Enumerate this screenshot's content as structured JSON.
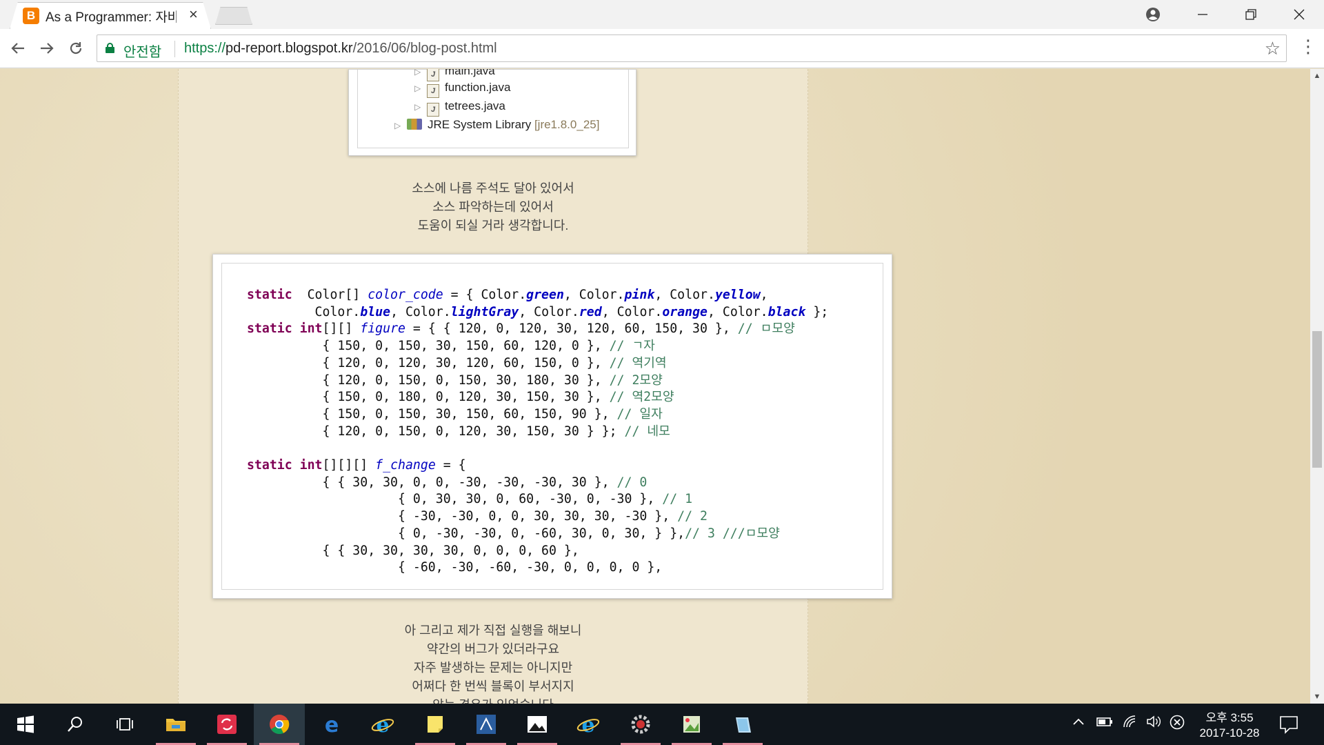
{
  "browser": {
    "tab_title": "As a Programmer: 자바",
    "tab_favicon": "B",
    "tab_close": "×",
    "secure_label": "안전함",
    "url_scheme": "https://",
    "url_host": "pd-report.blogspot.kr",
    "url_path": "/2016/06/blog-post.html",
    "icons": [
      "back-icon",
      "forward-icon",
      "reload-icon",
      "lock-icon",
      "star-icon",
      "menu-icon",
      "account-icon",
      "minimize-icon",
      "restore-icon",
      "close-icon"
    ]
  },
  "tree": {
    "items": [
      {
        "arrow": "▷",
        "name": "main.java",
        "suffix": ""
      },
      {
        "arrow": "▷",
        "name": "function.java",
        "suffix": ""
      },
      {
        "arrow": "▷",
        "name": "tetrees.java",
        "suffix": ""
      },
      {
        "arrow": "▷",
        "name": "JRE System Library",
        "suffix": "[jre1.8.0_25]"
      }
    ]
  },
  "post": {
    "para1": [
      "소스에 나름 주석도 달아 있어서",
      "소스 파악하는데 있어서",
      "도움이 되실 거라 생각합니다."
    ],
    "para2": [
      "아 그리고 제가 직접 실행을 해보니",
      "약간의 버그가 있더라구요",
      "자주 발생하는 문제는 아니지만",
      "어쩌다 한 번씩 블록이 부서지지",
      "않는 경우가 있었습니다"
    ]
  },
  "code": {
    "lines": [
      [
        [
          "kw",
          "static"
        ],
        [
          "",
          "  Color[] "
        ],
        [
          "fld",
          "color_code"
        ],
        [
          "",
          " = { Color."
        ],
        [
          "fldb",
          "green"
        ],
        [
          "",
          ", Color."
        ],
        [
          "fldb",
          "pink"
        ],
        [
          "",
          ", Color."
        ],
        [
          "fldb",
          "yellow"
        ],
        [
          "",
          ","
        ]
      ],
      [
        [
          "",
          "         Color."
        ],
        [
          "fldb",
          "blue"
        ],
        [
          "",
          ", Color."
        ],
        [
          "fldb",
          "lightGray"
        ],
        [
          "",
          ", Color."
        ],
        [
          "fldb",
          "red"
        ],
        [
          "",
          ", Color."
        ],
        [
          "fldb",
          "orange"
        ],
        [
          "",
          ", Color."
        ],
        [
          "fldb",
          "black"
        ],
        [
          "",
          " };"
        ]
      ],
      [
        [
          "kw",
          "static"
        ],
        [
          "kw",
          " int"
        ],
        [
          "",
          "[][] "
        ],
        [
          "fld",
          "figure"
        ],
        [
          "",
          " = { { 120, 0, 120, 30, 120, 60, 150, 30 }, "
        ],
        [
          "cmt",
          "// ㅁ모양"
        ]
      ],
      [
        [
          "",
          "          { 150, 0, 150, 30, 150, 60, 120, 0 }, "
        ],
        [
          "cmt",
          "// ㄱ자"
        ]
      ],
      [
        [
          "",
          "          { 120, 0, 120, 30, 120, 60, 150, 0 }, "
        ],
        [
          "cmt",
          "// 역기역"
        ]
      ],
      [
        [
          "",
          "          { 120, 0, 150, 0, 150, 30, 180, 30 }, "
        ],
        [
          "cmt",
          "// 2모양"
        ]
      ],
      [
        [
          "",
          "          { 150, 0, 180, 0, 120, 30, 150, 30 }, "
        ],
        [
          "cmt",
          "// 역2모양"
        ]
      ],
      [
        [
          "",
          "          { 150, 0, 150, 30, 150, 60, 150, 90 }, "
        ],
        [
          "cmt",
          "// 일자"
        ]
      ],
      [
        [
          "",
          "          { 120, 0, 150, 0, 120, 30, 150, 30 } }; "
        ],
        [
          "cmt",
          "// 네모"
        ]
      ],
      [
        [
          "",
          ""
        ]
      ],
      [
        [
          "kw",
          "static"
        ],
        [
          "kw",
          " int"
        ],
        [
          "",
          "[][][] "
        ],
        [
          "fld",
          "f_change"
        ],
        [
          "",
          " = {"
        ]
      ],
      [
        [
          "",
          "          { { 30, 30, 0, 0, -30, -30, -30, 30 }, "
        ],
        [
          "cmt",
          "// 0"
        ]
      ],
      [
        [
          "",
          "                    { 0, 30, 30, 0, 60, -30, 0, -30 }, "
        ],
        [
          "cmt",
          "// 1"
        ]
      ],
      [
        [
          "",
          "                    { -30, -30, 0, 0, 30, 30, 30, -30 }, "
        ],
        [
          "cmt",
          "// 2"
        ]
      ],
      [
        [
          "",
          "                    { 0, -30, -30, 0, -60, 30, 0, 30, } },"
        ],
        [
          "cmt",
          "// 3 ///ㅁ모양"
        ]
      ],
      [
        [
          "",
          "          { { 30, 30, 30, 30, 0, 0, 0, 60 },"
        ]
      ],
      [
        [
          "",
          "                    { -60, -30, -60, -30, 0, 0, 0, 0 },"
        ]
      ]
    ]
  },
  "taskbar": {
    "apps": [
      "start-icon",
      "search-icon",
      "task-view-icon",
      "file-explorer-icon",
      "sync-app-icon",
      "chrome-icon",
      "edge-icon",
      "internet-explorer-icon",
      "sticky-notes-icon",
      "ide-icon",
      "photos-icon",
      "internet-explorer-2-icon",
      "settings-app-icon",
      "image-editor-icon",
      "notepad-icon"
    ],
    "clock_time": "오후 3:55",
    "clock_date": "2017-10-28"
  }
}
